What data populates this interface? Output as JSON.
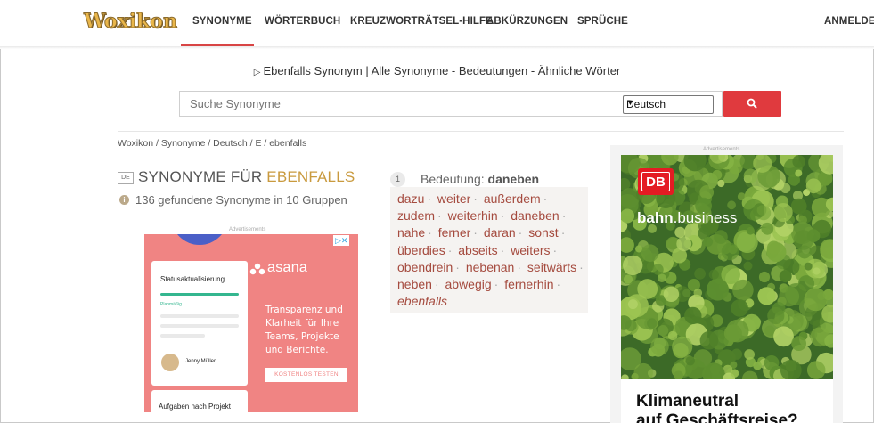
{
  "header": {
    "logo": "Woxikon",
    "nav": [
      "SYNONYME",
      "WÖRTERBUCH",
      "KREUZWORTRÄTSEL-HILFE",
      "ABKÜRZUNGEN",
      "SPRÜCHE"
    ],
    "login": "ANMELDEN",
    "active_color": "#d84545"
  },
  "intro": "Ebenfalls Synonym | Alle Synonyme - Bedeutungen - Ähnliche Wörter",
  "search": {
    "placeholder": "Suche Synonyme",
    "language": "Deutsch",
    "button_icon": "search-icon",
    "button_color": "#e03a3e"
  },
  "breadcrumb": "Woxikon / Synonyme / Deutsch / E / ebenfalls",
  "content": {
    "lang_badge": "DE",
    "title_prefix": "SYNONYME FÜR ",
    "title_word": "EBENFALLS",
    "count_text": "136 gefundene Synonyme in 10 Gruppen",
    "meaning": {
      "number": "1",
      "label": "Bedeutung: ",
      "word": "daneben",
      "synonyms": [
        "dazu",
        "weiter",
        "außerdem",
        "zudem",
        "weiterhin",
        "daneben",
        "nahe",
        "ferner",
        "daran",
        "sonst",
        "überdies",
        "abseits",
        "weiters",
        "obendrein",
        "nebenan",
        "seitwärts",
        "neben",
        "abwegig",
        "fernerhin"
      ],
      "last_italic": "ebenfalls"
    }
  },
  "ads": {
    "label": "Advertisements",
    "asana": {
      "card_title": "Statusaktualisierung",
      "status": "Planmäßig",
      "person": "Jenny Müller",
      "card2_title": "Aufgaben nach Projekt",
      "brand": "asana",
      "copy": "Transparenz und Klarheit für Ihre Teams, Projekte und Berichte.",
      "cta": "KOSTENLOS TESTEN",
      "adchoice": "▷✕"
    },
    "db": {
      "logo": "DB",
      "brand_a": "bahn",
      "brand_b": ".business",
      "headline_1": "Klimaneutral",
      "headline_2": "auf Geschäftsreise?"
    }
  }
}
